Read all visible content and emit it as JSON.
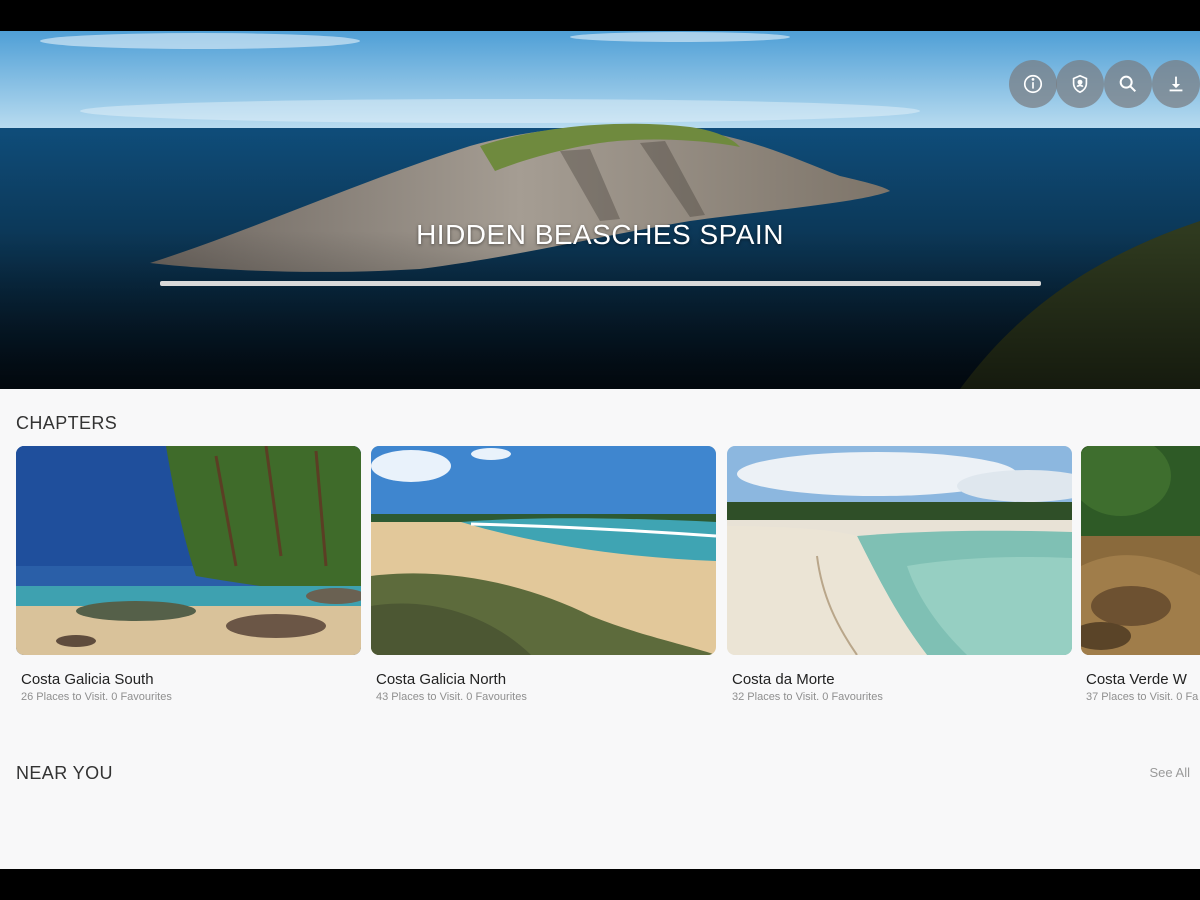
{
  "hero": {
    "title": "HIDDEN BEASCHES SPAIN"
  },
  "actions": [
    {
      "name": "info-icon"
    },
    {
      "name": "shield-icon"
    },
    {
      "name": "search-icon"
    },
    {
      "name": "download-icon"
    }
  ],
  "chapters": {
    "title": "CHAPTERS",
    "items": [
      {
        "name": "Costa Galicia South",
        "meta": "26 Places to Visit. 0 Favourites"
      },
      {
        "name": "Costa Galicia North",
        "meta": "43 Places to Visit. 0 Favourites"
      },
      {
        "name": "Costa da Morte",
        "meta": "32 Places to Visit. 0 Favourites"
      },
      {
        "name": "Costa Verde W",
        "meta": "37 Places to Visit. 0 Fa"
      }
    ]
  },
  "near_you": {
    "title": "NEAR YOU",
    "see_all": "See All"
  },
  "colors": {
    "sky": "#6cb3e0",
    "sea": "#0d3a5c",
    "background": "#f8f8f9",
    "hero_rule": "#d9d9d9"
  }
}
